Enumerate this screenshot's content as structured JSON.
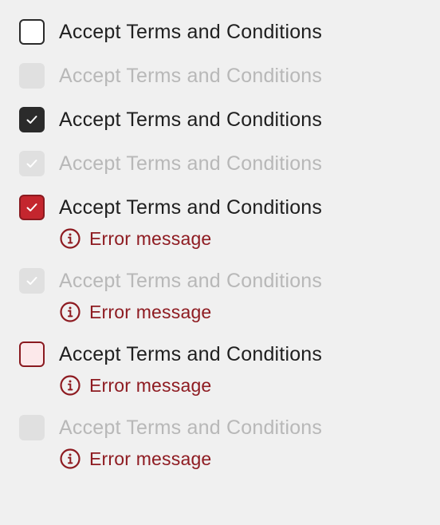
{
  "colors": {
    "page_bg": "#f0f0f0",
    "checked_fill": "#2b2b2b",
    "error_fill": "#c4262e",
    "error_text": "#8e1b21",
    "disabled_fill": "#e0e0e0",
    "disabled_text": "#b8b8b8"
  },
  "checkboxes": [
    {
      "label": "Accept Terms and Conditions",
      "state": "unchecked"
    },
    {
      "label": "Accept Terms and Conditions",
      "state": "disabled-unchecked"
    },
    {
      "label": "Accept Terms and Conditions",
      "state": "checked",
      "icon": "checkmark-icon"
    },
    {
      "label": "Accept Terms and Conditions",
      "state": "disabled-checked",
      "icon": "checkmark-icon"
    },
    {
      "label": "Accept Terms and Conditions",
      "state": "error-checked",
      "icon": "checkmark-icon",
      "error": "Error message"
    },
    {
      "label": "Accept Terms and Conditions",
      "state": "disabled-checked-error",
      "icon": "checkmark-icon",
      "error": "Error message"
    },
    {
      "label": "Accept Terms and Conditions",
      "state": "error-unchecked",
      "error": "Error message"
    },
    {
      "label": "Accept Terms and Conditions",
      "state": "disabled-unchecked-error",
      "error": "Error message"
    }
  ],
  "error_icon": "info-circle-icon"
}
